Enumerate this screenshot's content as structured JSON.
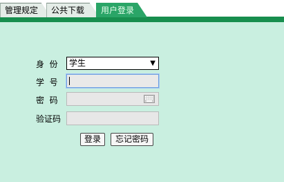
{
  "tabs": [
    {
      "label": "管理规定",
      "active": false
    },
    {
      "label": "公共下载",
      "active": false
    },
    {
      "label": "用户登录",
      "active": true
    }
  ],
  "form": {
    "identity_label": "身  份",
    "identity_value": "学生",
    "student_id_label": "学  号",
    "student_id_value": "",
    "password_label": "密  码",
    "password_value": "",
    "captcha_label": "验证码",
    "captcha_value": ""
  },
  "buttons": {
    "login": "登录",
    "forgot_password": "忘记密码"
  },
  "colors": {
    "background": "#c9efe0",
    "tab_bar": "#178e4e",
    "active_tab": "#2aa567"
  }
}
